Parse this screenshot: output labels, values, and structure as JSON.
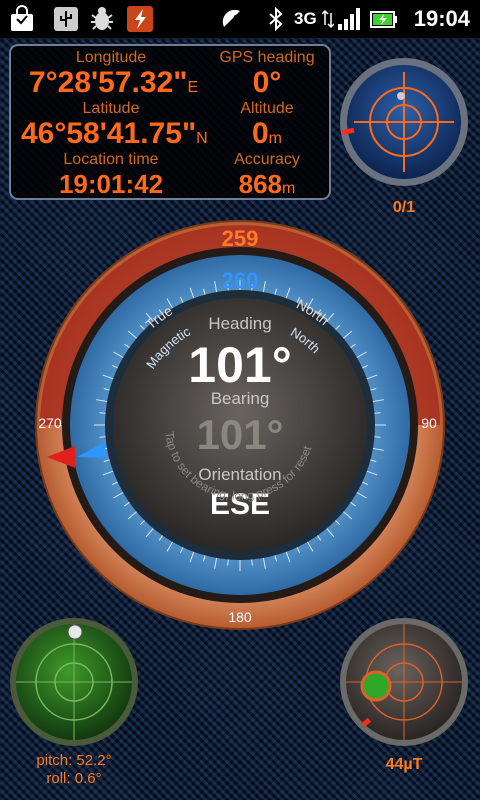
{
  "status_bar": {
    "time": "19:04",
    "network": "3G",
    "icons": [
      "shopping-bag-icon",
      "usb-icon",
      "bug-icon",
      "flash-app-icon",
      "gps-satellite-icon",
      "bluetooth-icon",
      "signal-icon",
      "battery-charging-icon"
    ]
  },
  "info": {
    "longitude_label": "Longitude",
    "longitude_value": "7°28'57.32\"",
    "longitude_dir": "E",
    "gps_heading_label": "GPS heading",
    "gps_heading_value": "0°",
    "latitude_label": "Latitude",
    "latitude_value": "46°58'41.75\"",
    "latitude_dir": "N",
    "altitude_label": "Altitude",
    "altitude_value": "0",
    "altitude_unit": "m",
    "location_time_label": "Location time",
    "location_time_value": "19:01:42",
    "accuracy_label": "Accuracy",
    "accuracy_value": "868",
    "accuracy_unit": "m"
  },
  "satellites": {
    "count": "0/1"
  },
  "compass": {
    "true_label": "True",
    "true_value": "259",
    "true_north": "North",
    "magnetic_label": "Magnetic",
    "magnetic_value": "260",
    "magnetic_north": "North",
    "heading_label": "Heading",
    "heading_value": "101°",
    "bearing_label": "Bearing",
    "bearing_value": "101°",
    "orientation_label": "Orientation",
    "orientation_value": "ESE",
    "hint": "Tap to set bearing, long press for reset",
    "cardinal_w": "270",
    "cardinal_e": "90",
    "cardinal_s": "180",
    "colors": {
      "true_ring": "#a52c1d",
      "outer_ring": "#c8703f",
      "magnetic_ring": "#3f7bb5",
      "accent": "#ff6a1a",
      "magnetic_accent": "#2f95ff"
    }
  },
  "level": {
    "pitch": "pitch: 52.2°",
    "roll": "roll: 0.6°"
  },
  "magnetometer": {
    "field": "44µT"
  }
}
